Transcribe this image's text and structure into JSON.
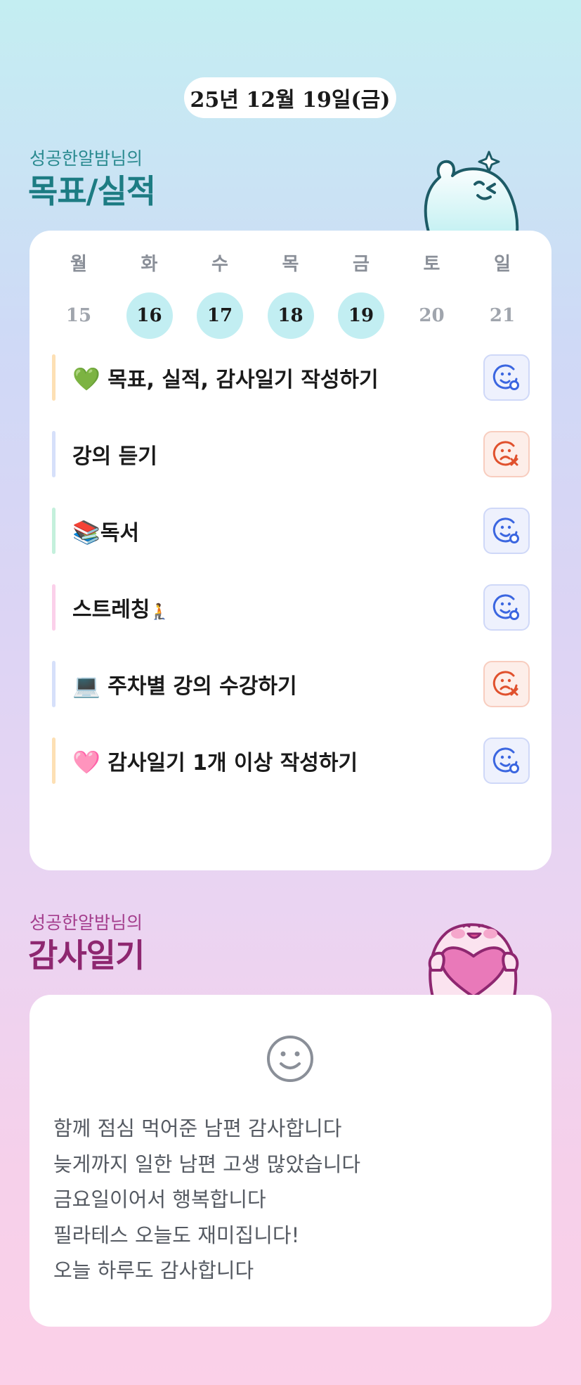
{
  "date": "25년 12월 19일(금)",
  "goals_section": {
    "subtitle": "성공한알밤님의",
    "title": "목표/실적"
  },
  "week": {
    "days": [
      {
        "name": "월",
        "num": "15",
        "active": false
      },
      {
        "name": "화",
        "num": "16",
        "active": true
      },
      {
        "name": "수",
        "num": "17",
        "active": true
      },
      {
        "name": "목",
        "num": "18",
        "active": true
      },
      {
        "name": "금",
        "num": "19",
        "active": true
      },
      {
        "name": "토",
        "num": "20",
        "active": false
      },
      {
        "name": "일",
        "num": "21",
        "active": false
      }
    ]
  },
  "goals": [
    {
      "prefix": "💚",
      "text": " 목표, 실적, 감사일기 작성하기",
      "suffix": "",
      "bar_color": "#fde0b4",
      "status": "done",
      "status_icon": "smile-check-icon"
    },
    {
      "prefix": "",
      "text": "강의 듣기",
      "suffix": "",
      "bar_color": "#d6e0fa",
      "status": "fail",
      "status_icon": "sad-x-icon"
    },
    {
      "prefix": "📚",
      "text": "독서",
      "suffix": "",
      "bar_color": "#c4f0dc",
      "status": "done",
      "status_icon": "smile-check-icon"
    },
    {
      "prefix": "",
      "text": "스트레칭",
      "suffix": "🧎",
      "bar_color": "#fbd0ea",
      "status": "done",
      "status_icon": "smile-check-icon"
    },
    {
      "prefix": "💻",
      "text": " 주차별 강의 수강하기",
      "suffix": "",
      "bar_color": "#d6e0fa",
      "status": "fail",
      "status_icon": "sad-x-icon"
    },
    {
      "prefix": "🩷",
      "text": " 감사일기 1개 이상 작성하기",
      "suffix": "",
      "bar_color": "#fde0b4",
      "status": "done",
      "status_icon": "smile-check-icon"
    }
  ],
  "gratitude_section": {
    "subtitle": "성공한알밤님의",
    "title": "감사일기",
    "mood_icon": "smile-face-icon",
    "lines": [
      "함께 점심 먹어준 남편 감사합니다",
      "늦게까지 일한 남편 고생 많았습니다",
      "금요일이어서 행복합니다",
      "필라테스 오늘도 재미집니다!",
      "오늘 하루도 감사합니다"
    ]
  },
  "colors": {
    "goals_accent": "#1d7c83",
    "gratitude_accent": "#8e2770",
    "active_day": "#c2eef2",
    "done_icon": "#3b66e0",
    "fail_icon": "#e0512d"
  }
}
